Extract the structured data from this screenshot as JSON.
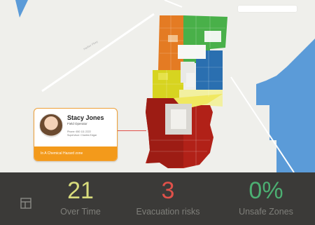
{
  "map": {
    "street": "Harbor Pkwy",
    "icons": {
      "layout": "layout-icon"
    }
  },
  "worker_card": {
    "name": "Stacy Jones",
    "role": "Field Operator",
    "phone": "Phone: 650 111 2222",
    "supervisor": "Supervisor: Charles Edgar",
    "alert": "In A Chemical Hazard zone"
  },
  "stats": [
    {
      "value": "21",
      "label": "Over Time",
      "color": "#d8dc7c"
    },
    {
      "value": "3",
      "label": "Evacuation risks",
      "color": "#e0514a"
    },
    {
      "value": "0%",
      "label": "Unsafe Zones",
      "color": "#4caf72"
    }
  ],
  "colors": {
    "water": "#5b9bd8",
    "panel": "#3b3a38",
    "accent_orange": "#f39a1b"
  }
}
